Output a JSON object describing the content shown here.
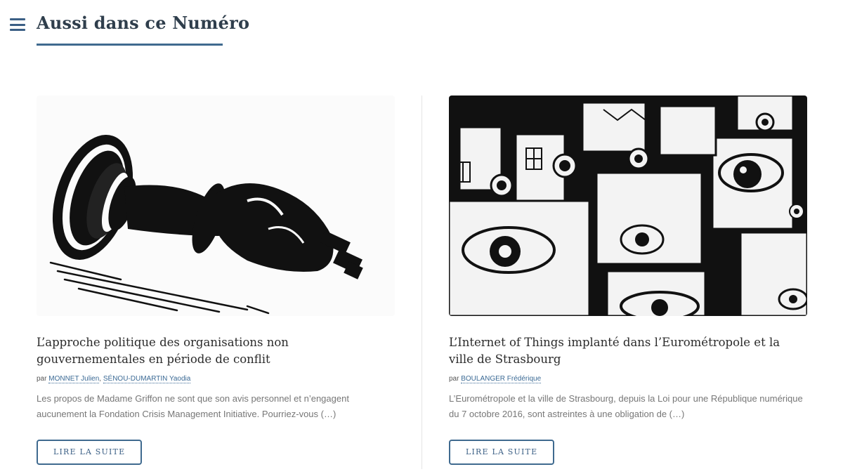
{
  "section": {
    "title": "Aussi dans ce Numéro"
  },
  "articles": [
    {
      "title": "L’approche politique des organisations non gouvernementales en période de conflit",
      "by_prefix": "par",
      "authors": [
        "MONNET Julien",
        "SÉNOU-DUMARTIN Yaodia"
      ],
      "author_separator": ",",
      "excerpt": "Les propos de Madame Griffon ne sont que son avis personnel et n’engagent aucunement la Fondation Crisis Management Initiative. Pourriez-vous (…)",
      "button": "LIRE LA SUITE",
      "image_icon": "fallen-chess-king-illustration"
    },
    {
      "title": "L’Internet of Things implanté dans l’Eurométropole et la ville de Strasbourg",
      "by_prefix": "par",
      "authors": [
        "BOULANGER Frédérique"
      ],
      "excerpt": "L’Eurométropole et la ville de Strasbourg, depuis la Loi pour une République numérique du 7 octobre 2016, sont astreintes à une obligation de (…)",
      "button": "LIRE LA SUITE",
      "image_icon": "surveillance-eyes-buildings-illustration"
    }
  ],
  "colors": {
    "accent": "#3f6a8f",
    "link": "#3b6a95",
    "title": "#2f3e4c"
  }
}
